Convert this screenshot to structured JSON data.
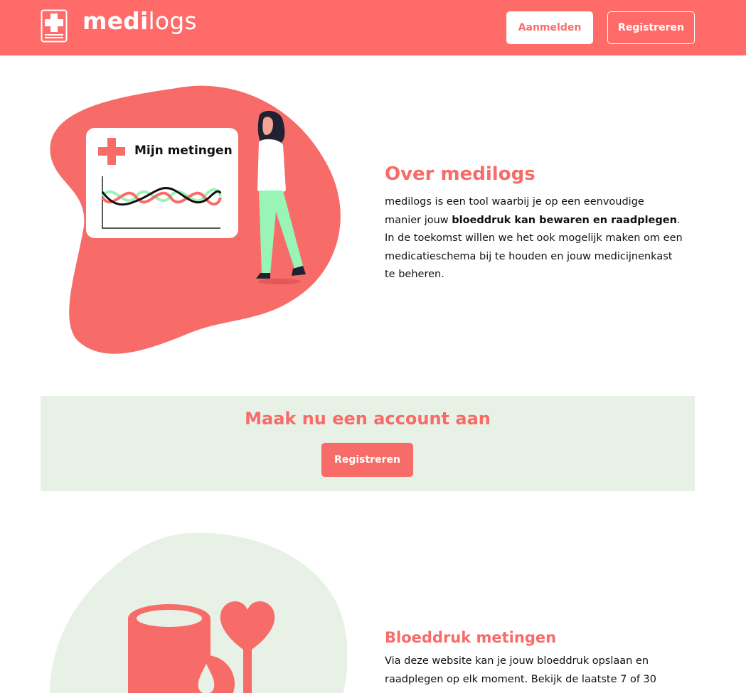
{
  "header": {
    "logo_bold": "medi",
    "logo_light": "logs",
    "login_label": "Aanmelden",
    "register_label": "Registreren"
  },
  "about": {
    "card_title": "Mijn metingen",
    "title": "Over medilogs",
    "text_before": "medilogs is een tool waarbij je op een eenvoudige manier jouw ",
    "text_bold": "bloeddruk kan bewaren en raadplegen",
    "text_after": ". In de toekomst willen we het ook mogelijk maken om een medicatieschema bij te houden en jouw medicijnenkast te beheren."
  },
  "cta": {
    "title": "Maak nu een account aan",
    "button_label": "Registreren"
  },
  "bloodpressure": {
    "title": "Bloeddruk metingen",
    "text": "Via deze website kan je jouw bloeddruk opslaan en raadplegen op elk moment. Bekijk de laatste 7 of 30"
  },
  "colors": {
    "brand": "#ff6b68",
    "cta_background": "#e8f1e6",
    "wave_green": "#98f5b5"
  },
  "icons": [
    "medical-cross-icon",
    "heart-icon",
    "blood-drop-icon"
  ]
}
